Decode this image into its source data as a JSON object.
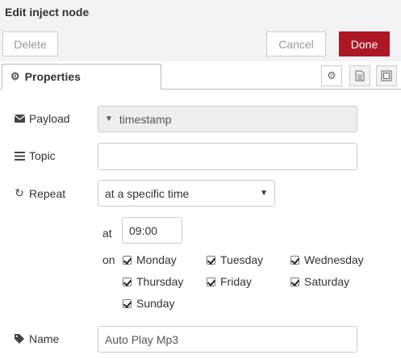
{
  "header": {
    "title": "Edit inject node"
  },
  "toolbar": {
    "delete_label": "Delete",
    "cancel_label": "Cancel",
    "done_label": "Done"
  },
  "tabs": {
    "properties_label": "Properties"
  },
  "form": {
    "payload": {
      "label": "Payload",
      "value": "timestamp"
    },
    "topic": {
      "label": "Topic",
      "value": ""
    },
    "repeat": {
      "label": "Repeat",
      "value": "at a specific time"
    },
    "at_label": "at",
    "time_value": "09:00",
    "on_label": "on",
    "days": [
      {
        "label": "Monday",
        "checked": true
      },
      {
        "label": "Tuesday",
        "checked": true
      },
      {
        "label": "Wednesday",
        "checked": true
      },
      {
        "label": "Thursday",
        "checked": true
      },
      {
        "label": "Friday",
        "checked": true
      },
      {
        "label": "Saturday",
        "checked": true
      },
      {
        "label": "Sunday",
        "checked": true
      }
    ],
    "name": {
      "label": "Name",
      "value": "Auto Play Mp3"
    }
  },
  "colors": {
    "done": "#ad1625",
    "titlebar": "#f3f3f3"
  }
}
